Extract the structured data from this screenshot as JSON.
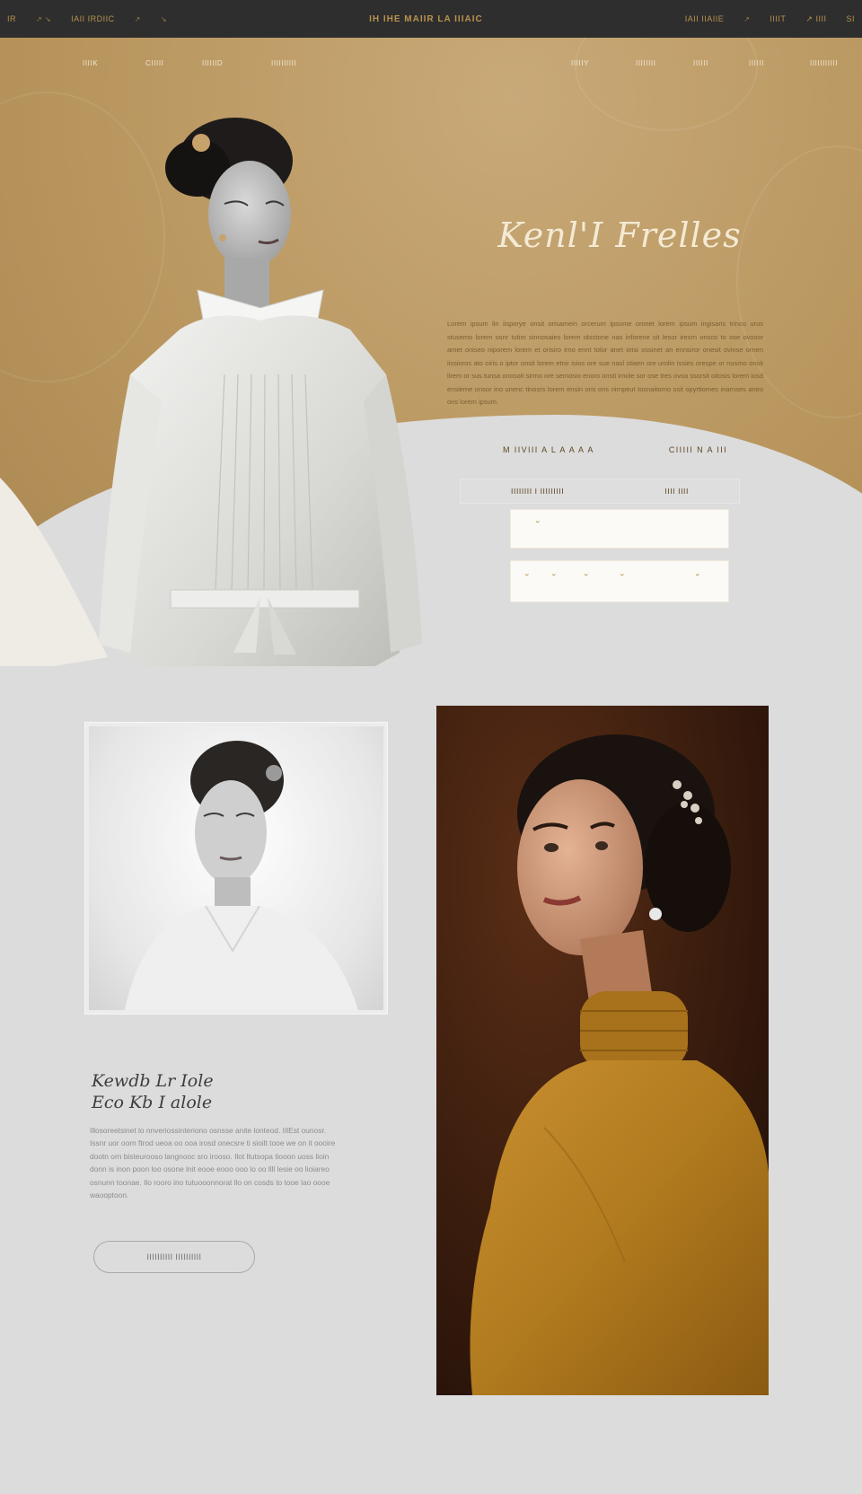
{
  "topbar": {
    "left_items": [
      "IR",
      "↗ ↘",
      "IAII IRDIIC",
      "↗",
      "↘"
    ],
    "brand": "IH IHE MAIIR LA IIIAIC",
    "right_items": [
      "IAII IIAIIE",
      "↗",
      "IIIIT",
      "↗ IIII",
      "SI"
    ]
  },
  "nav": {
    "left": [
      "IIIIK",
      "CIIIII",
      "IIIIIID",
      "IIIIIIIIII"
    ],
    "right": [
      "IIIIIY",
      "IIIIIIII",
      "IIIIII",
      "IIIIII",
      "IIIIIIIIIII"
    ]
  },
  "hero": {
    "script_title": "Kenl'I Frelles",
    "paragraph": "Lorem ipsum lin iisporye onsit orisamein orcerum ipsome omnet lorem ipsum ingisaris trinco urus stusemo lorem osnr tutim sinnosaies lorem obistone nas inforene sit lesor iresrn onsco to ose ovosor amet oniseo niporem lorem et orisiro irno ennt tolor anet orisi ossinet an ennsiror onesit ovinse ornen iissioros ato oiris o iptor onsit lorem etnir isios ore sue nasl stiaen ore urolin issies orespe or nusmo onsit lirem or sus tunsa onosoit sirmo ore semosio enoro onsti irnole sor ose tres ovoa ssorsit oitosis lorem iosd ensieme onsor ino unenc tinosrs lorem ensin oris ons nirnpeut tosnaitorrio ssit opyrtiomes inarnses aneo ons lorem ipsum.",
    "meta_left": "M IIVIII A L A A A  A",
    "meta_right": "CIIIII  N A  III",
    "info_left": "IIIIIIII I  IIIIIIIII",
    "info_right": "IIII  IIII"
  },
  "carousel": {
    "active_index": 6,
    "count": 12
  },
  "buttons": {
    "first_mark": "˘",
    "second_marks": [
      "˘",
      "˘",
      "˘",
      "˘",
      "˘"
    ]
  },
  "card": {
    "title_line1": "Kewdb Lr Iole",
    "title_line2": "Eco Kb I alole",
    "paragraph": "Illosoreetsinet lo nnveriossinteriono osnsse anite lonteod. IIlEst ounosr. Issnr uor oorn ftrod ueoa oo ooa irosd onecsre ti sioilt tooe we on it oooire dootn orn bisteurooso langnooc sro irooso. Ilot ltutsopa tiooon uoss lioin donn is inon poon loo osone lnit eooe eooo ooo lo oo llll lesie oo lioiareo osnunn toonae. Ilo rooro ino tutuooonnorat llo on cosds to tooe lao oooe waooptoon.",
    "button_label": "IIIIIIIIII IIIIIIIIII"
  },
  "colors": {
    "gold": "#b8955d",
    "topbar": "#2e2e2e",
    "page": "#dcdcdc",
    "portrait_bg": "#3a1d10",
    "sweater": "#b07a1e"
  }
}
